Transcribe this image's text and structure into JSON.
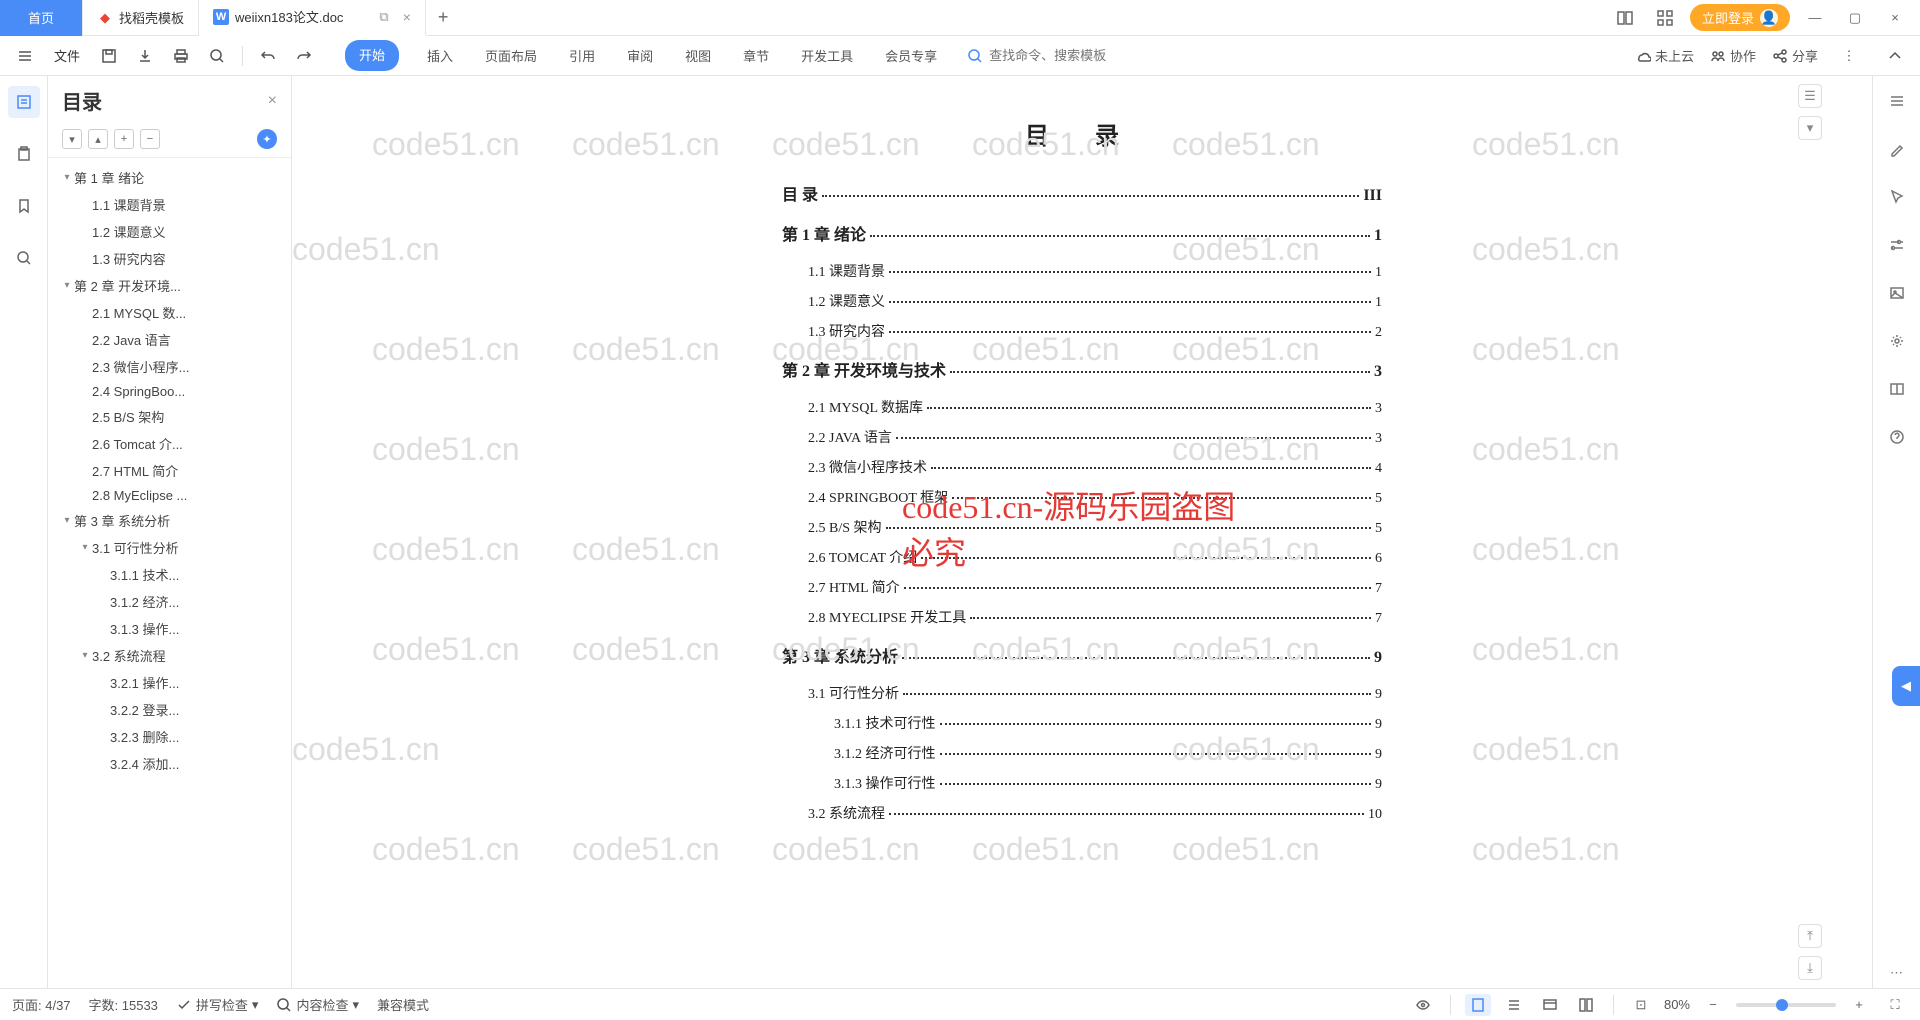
{
  "titlebar": {
    "home": "首页",
    "tab1": {
      "label": "找稻壳模板"
    },
    "tab2": {
      "label": "weiixn183论文.doc"
    },
    "login": "立即登录"
  },
  "toolbar": {
    "file": "文件",
    "menu": [
      "开始",
      "插入",
      "页面布局",
      "引用",
      "审阅",
      "视图",
      "章节",
      "开发工具",
      "会员专享"
    ],
    "search_placeholder": "查找命令、搜索模板",
    "cloud": "未上云",
    "collab": "协作",
    "share": "分享"
  },
  "outline": {
    "title": "目录",
    "tree": [
      {
        "t": "第 1 章 绪论",
        "lv": 0,
        "exp": true
      },
      {
        "t": "1.1 课题背景",
        "lv": 1
      },
      {
        "t": "1.2 课题意义",
        "lv": 1
      },
      {
        "t": "1.3 研究内容",
        "lv": 1
      },
      {
        "t": "第 2 章 开发环境...",
        "lv": 0,
        "exp": true
      },
      {
        "t": "2.1 MYSQL 数...",
        "lv": 1
      },
      {
        "t": "2.2 Java 语言",
        "lv": 1
      },
      {
        "t": "2.3 微信小程序...",
        "lv": 1
      },
      {
        "t": "2.4 SpringBoo...",
        "lv": 1
      },
      {
        "t": "2.5 B/S 架构",
        "lv": 1
      },
      {
        "t": "2.6 Tomcat  介...",
        "lv": 1
      },
      {
        "t": "2.7 HTML 简介",
        "lv": 1
      },
      {
        "t": "2.8 MyEclipse ...",
        "lv": 1
      },
      {
        "t": "第 3 章 系统分析",
        "lv": 0,
        "exp": true
      },
      {
        "t": "3.1 可行性分析",
        "lv": 1,
        "exp": true
      },
      {
        "t": "3.1.1 技术...",
        "lv": 2
      },
      {
        "t": "3.1.2 经济...",
        "lv": 2
      },
      {
        "t": "3.1.3 操作...",
        "lv": 2
      },
      {
        "t": "3.2 系统流程",
        "lv": 1,
        "exp": true
      },
      {
        "t": "3.2.1 操作...",
        "lv": 2
      },
      {
        "t": "3.2.2 登录...",
        "lv": 2
      },
      {
        "t": "3.2.3 删除...",
        "lv": 2
      },
      {
        "t": "3.2.4 添加...",
        "lv": 2
      }
    ]
  },
  "doc": {
    "title": "目 录",
    "toc": [
      {
        "label": "目 录",
        "page": "III",
        "bold": true,
        "lv": 0
      },
      {
        "label": "第 1 章  绪论",
        "page": "1",
        "bold": true,
        "lv": 0
      },
      {
        "label": "1.1 课题背景",
        "page": "1",
        "lv": 1
      },
      {
        "label": "1.2 课题意义",
        "page": "1",
        "lv": 1
      },
      {
        "label": "1.3 研究内容",
        "page": "2",
        "lv": 1
      },
      {
        "label": "第 2 章  开发环境与技术",
        "page": "3",
        "bold": true,
        "lv": 0
      },
      {
        "label": "2.1 MYSQL 数据库",
        "page": "3",
        "lv": 1
      },
      {
        "label": "2.2 JAVA 语言",
        "page": "3",
        "lv": 1
      },
      {
        "label": "2.3 微信小程序技术",
        "page": "4",
        "lv": 1
      },
      {
        "label": "2.4 SPRINGBOOT 框架",
        "page": "5",
        "lv": 1
      },
      {
        "label": "2.5 B/S 架构",
        "page": "5",
        "lv": 1
      },
      {
        "label": "2.6 TOMCAT  介绍",
        "page": "6",
        "lv": 1
      },
      {
        "label": "2.7 HTML 简介",
        "page": "7",
        "lv": 1
      },
      {
        "label": "2.8 MYECLIPSE  开发工具",
        "page": "7",
        "lv": 1
      },
      {
        "label": "第 3 章  系统分析",
        "page": "9",
        "bold": true,
        "lv": 0
      },
      {
        "label": "3.1 可行性分析",
        "page": "9",
        "lv": 1
      },
      {
        "label": "3.1.1 技术可行性",
        "page": "9",
        "lv": 2
      },
      {
        "label": "3.1.2 经济可行性",
        "page": "9",
        "lv": 2
      },
      {
        "label": "3.1.3 操作可行性",
        "page": "9",
        "lv": 2
      },
      {
        "label": "3.2 系统流程",
        "page": "10",
        "lv": 1
      }
    ],
    "watermark": "code51.cn",
    "watermark_red": "code51.cn-源码乐园盗图必究"
  },
  "status": {
    "page": "页面: 4/37",
    "words": "字数: 15533",
    "spell": "拼写检查",
    "content": "内容检查",
    "compat": "兼容模式",
    "zoom": "80%"
  }
}
